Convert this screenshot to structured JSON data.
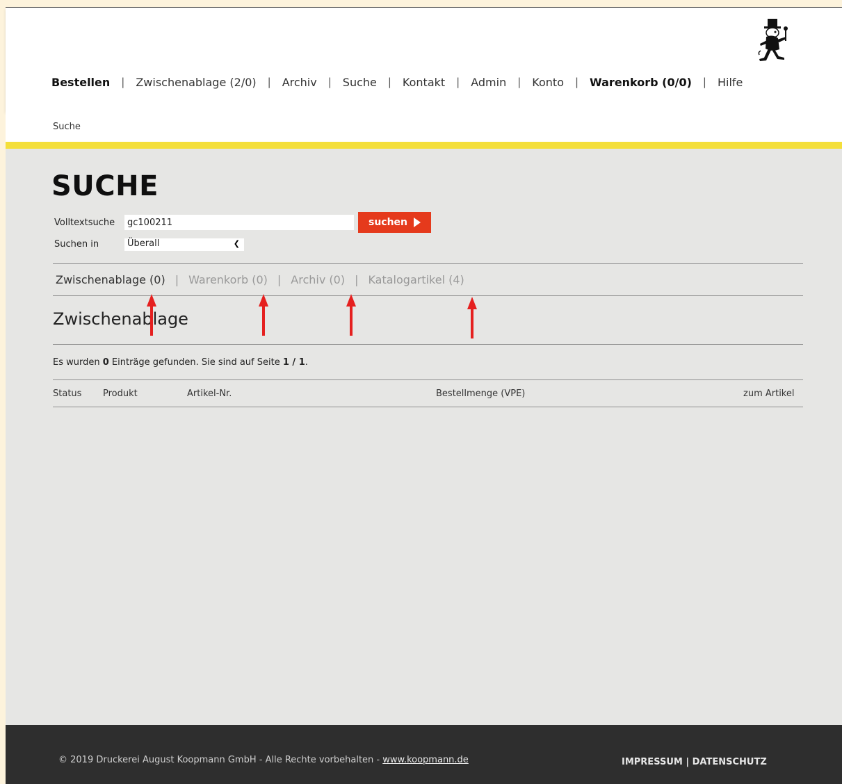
{
  "nav": {
    "items": [
      {
        "label": "Bestellen",
        "bold": true
      },
      {
        "label": "Zwischenablage (2/0)",
        "bold": false
      },
      {
        "label": "Archiv",
        "bold": false
      },
      {
        "label": "Suche",
        "bold": false
      },
      {
        "label": "Kontakt",
        "bold": false
      },
      {
        "label": "Admin",
        "bold": false
      },
      {
        "label": "Konto",
        "bold": false
      },
      {
        "label": "Warenkorb (0/0)",
        "bold": true
      },
      {
        "label": "Hilfe",
        "bold": false
      }
    ],
    "separator": "|"
  },
  "breadcrumb": "Suche",
  "page_title": "SUCHE",
  "search": {
    "fulltext_label": "Volltextsuche",
    "fulltext_value": "gc100211",
    "button_label": "suchen",
    "scope_label": "Suchen in",
    "scope_value": "Überall"
  },
  "tabs": [
    {
      "label": "Zwischenablage (0)",
      "active": true
    },
    {
      "label": "Warenkorb (0)",
      "active": false
    },
    {
      "label": "Archiv (0)",
      "active": false
    },
    {
      "label": "Katalogartikel (4)",
      "active": false
    }
  ],
  "section_title": "Zwischenablage",
  "results": {
    "prefix": "Es wurden ",
    "count": "0",
    "middle": " Einträge gefunden. Sie sind auf Seite ",
    "page": "1 / 1",
    "suffix": "."
  },
  "table": {
    "columns": [
      "Status",
      "Produkt",
      "Artikel-Nr.",
      "Bestellmenge (VPE)",
      "zum Artikel"
    ]
  },
  "footer": {
    "copyright": "© 2019 Druckerei August Koopmann GmbH - Alle Rechte vorbehalten - ",
    "link": "www.koopmann.de",
    "impressum": "IMPRESSUM",
    "link_separator": "|",
    "datenschutz": "DATENSCHUTZ"
  },
  "colors": {
    "accent_red": "#e53a1c",
    "yellow_bar": "#f4df3b",
    "annotation_arrow": "#e5201f",
    "footer_bg": "#2e2e2e",
    "page_bg": "#e6e6e4"
  },
  "icons": {
    "logo": "chimney-sweep-logo-icon",
    "arrow": "red-up-arrow-icon",
    "dropdown": "chevron-down-icon",
    "button": "play-triangle-icon"
  }
}
